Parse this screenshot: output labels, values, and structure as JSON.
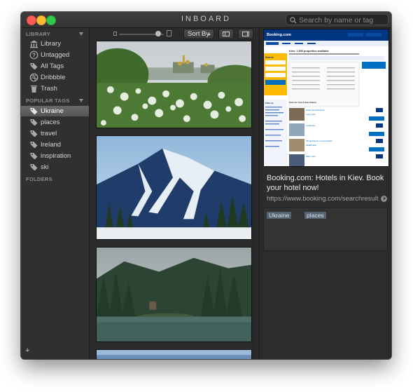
{
  "window": {
    "title": "INBOARD"
  },
  "search": {
    "placeholder": "Search by name or tag"
  },
  "sidebar": {
    "library_header": "LIBRARY",
    "library_items": [
      {
        "label": "Library",
        "icon": "library-icon"
      },
      {
        "label": "Untagged",
        "icon": "question-icon"
      },
      {
        "label": "All Tags",
        "icon": "tags-icon"
      },
      {
        "label": "Dribbble",
        "icon": "dribbble-icon"
      },
      {
        "label": "Trash",
        "icon": "trash-icon"
      }
    ],
    "popular_header": "POPULAR TAGS",
    "tags": [
      {
        "label": "Ukraine",
        "selected": true
      },
      {
        "label": "places"
      },
      {
        "label": "travel"
      },
      {
        "label": "Ireland"
      },
      {
        "label": "inspiration"
      },
      {
        "label": "ski"
      }
    ],
    "folders_header": "FOLDERS",
    "add_label": "+"
  },
  "toolbar": {
    "sort_label": "Sort By"
  },
  "detail": {
    "title": "Booking.com: Hotels in Kiev. Book your hotel now!",
    "url": "https://www.booking.com/searchresult...",
    "tags": [
      "Ukraine",
      "places"
    ],
    "preview": {
      "logo": "Booking.com",
      "heading": "Kiev: 1,955 properties available",
      "search_label": "Search",
      "filter_label": "Filter by",
      "list_label": "Over for Your Fresh Clients",
      "hotels": [
        "Hotel Vozdvizhenka",
        "Lucky Hotel",
        "Lusterkee",
        "VP apartment on Kreschatik",
        "Radlliff Hotel",
        "Zlatiy Kiev"
      ]
    }
  },
  "colors": {
    "accent_tag": "#556272",
    "selection": "#5f5f5f"
  }
}
